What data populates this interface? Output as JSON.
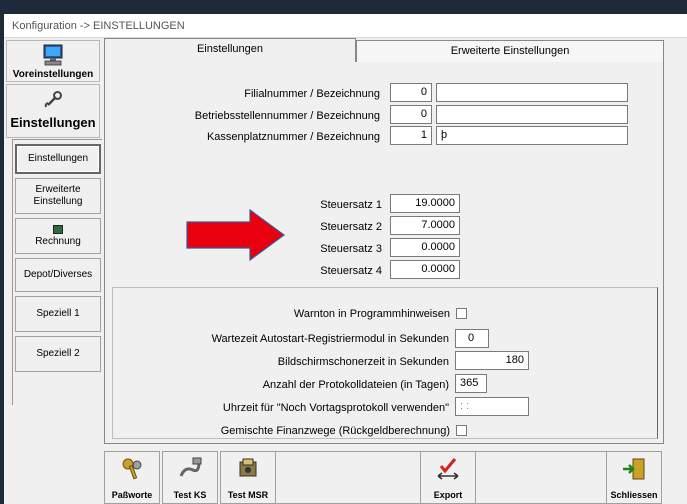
{
  "window": {
    "title": "Konfiguration -> EINSTELLUNGEN"
  },
  "sidebar": {
    "main": [
      {
        "label": "Voreinstellungen",
        "icon": "computer-icon"
      },
      {
        "label": "Einstellungen",
        "icon": "tools-icon"
      }
    ],
    "sub": [
      {
        "label": "Einstellungen",
        "active": true
      },
      {
        "label": "Erweiterte Einstellung"
      },
      {
        "label": "Rechnung",
        "icon": "register-icon"
      },
      {
        "label": "Depot/Diverses"
      },
      {
        "label": "Speziell 1"
      },
      {
        "label": "Speziell 2"
      }
    ]
  },
  "tabs": [
    {
      "label": "Einstellungen",
      "active": true
    },
    {
      "label": "Erweiterte Einstellungen",
      "active": false
    }
  ],
  "ids": {
    "filiale": {
      "label": "Filialnummer / Bezeichnung",
      "number": "0",
      "name": ""
    },
    "betriebsstelle": {
      "label": "Betriebsstellennummer / Bezeichnung",
      "number": "0",
      "name": ""
    },
    "kassenplatz": {
      "label": "Kassenplatznummer / Bezeichnung",
      "number": "1",
      "name": "þ"
    }
  },
  "tax": [
    {
      "label": "Steuersatz 1",
      "value": "19.0000"
    },
    {
      "label": "Steuersatz 2",
      "value": "7.0000"
    },
    {
      "label": "Steuersatz 3",
      "value": "0.0000"
    },
    {
      "label": "Steuersatz 4",
      "value": "0.0000"
    }
  ],
  "misc": {
    "warnton": {
      "label": "Warnton in Programmhinweisen",
      "checked": false
    },
    "wartezeit": {
      "label": "Wartezeit Autostart-Registriermodul in Sekunden",
      "value": "0"
    },
    "bildschirmschoner": {
      "label": "Bildschirmschonerzeit in Sekunden",
      "value": "180"
    },
    "protokoll": {
      "label": "Anzahl der Protokolldateien (in Tagen)",
      "value": "365"
    },
    "uhrzeit": {
      "label": "Uhrzeit für \"Noch Vortagsprotokoll verwenden\"",
      "value": " : :"
    },
    "finanzwege": {
      "label": "Gemischte Finanzwege (Rückgeldberechnung)",
      "checked": false
    }
  },
  "toolbar": {
    "passworte": "Paßworte",
    "testks": "Test KS",
    "testmsr": "Test MSR",
    "export": "Export",
    "schliessen": "Schliessen"
  },
  "colors": {
    "arrow": "#e8000f",
    "arrow_outline": "#3a5a9a"
  }
}
